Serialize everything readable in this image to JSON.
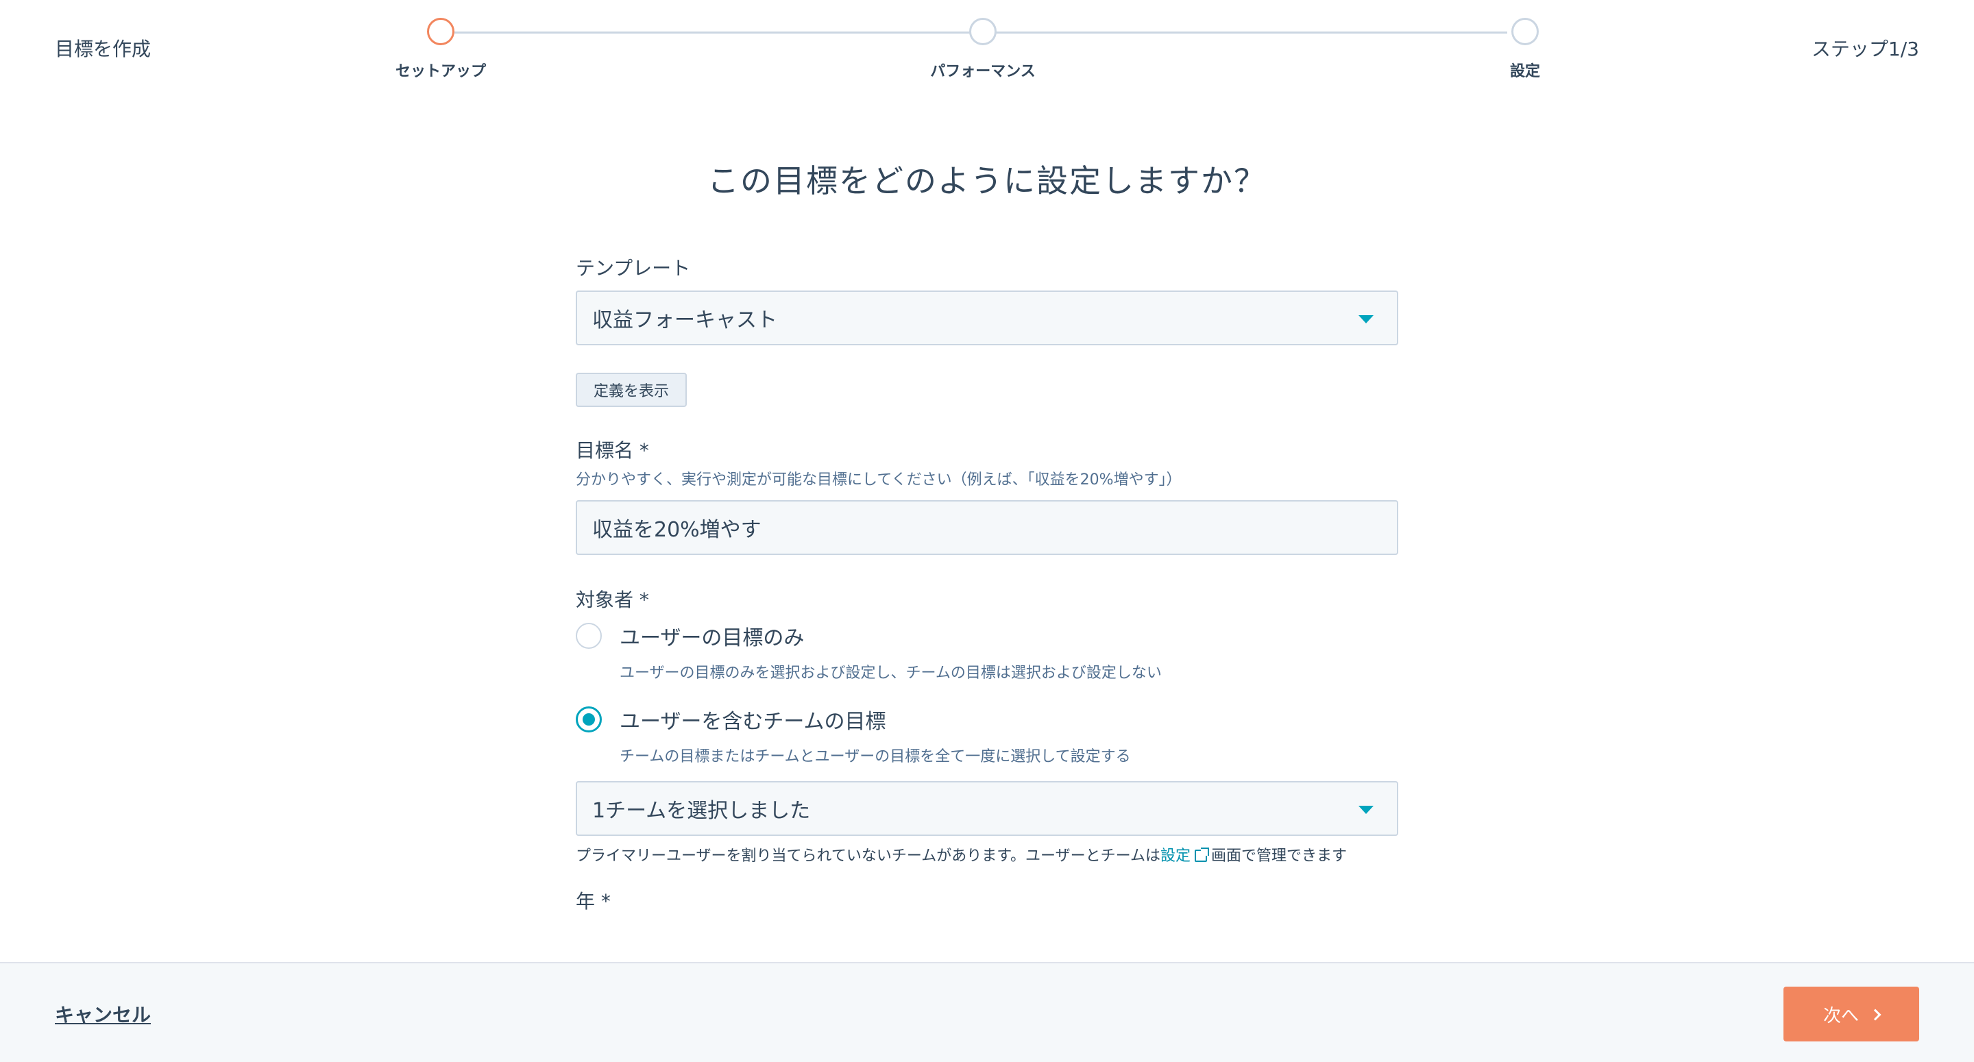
{
  "header": {
    "title": "目標を作成",
    "step_count": "ステップ1/3",
    "steps": [
      {
        "label": "セットアップ",
        "active": true
      },
      {
        "label": "パフォーマンス",
        "active": false
      },
      {
        "label": "設定",
        "active": false
      }
    ]
  },
  "main": {
    "question": "この目標をどのように設定しますか？",
    "template": {
      "label": "テンプレート",
      "value": "収益フォーキャスト",
      "definition_button": "定義を表示"
    },
    "goal_name": {
      "label": "目標名 *",
      "help": "分かりやすく、実行や測定が可能な目標にしてください（例えば、「収益を20%増やす」）",
      "value": "収益を20%増やす"
    },
    "audience": {
      "label": "対象者 *",
      "options": [
        {
          "label": "ユーザーの目標のみ",
          "description": "ユーザーの目標のみを選択および設定し、チームの目標は選択および設定しない",
          "checked": false
        },
        {
          "label": "ユーザーを含むチームの目標",
          "description": "チームの目標またはチームとユーザーの目標を全て一度に選択して設定する",
          "checked": true
        }
      ],
      "team_select_value": "1チームを選択しました",
      "team_help_before": "プライマリーユーザーを割り当てられていないチームがあります。ユーザーとチームは",
      "team_help_link": "設定",
      "team_help_after": "画面で管理できます"
    },
    "year": {
      "label": "年 *"
    }
  },
  "footer": {
    "cancel_label": "キャンセル",
    "next_label": "次へ"
  },
  "colors": {
    "accent": "#f2865e",
    "teal": "#00a4bd",
    "text": "#33475b",
    "link": "#0091ae"
  }
}
